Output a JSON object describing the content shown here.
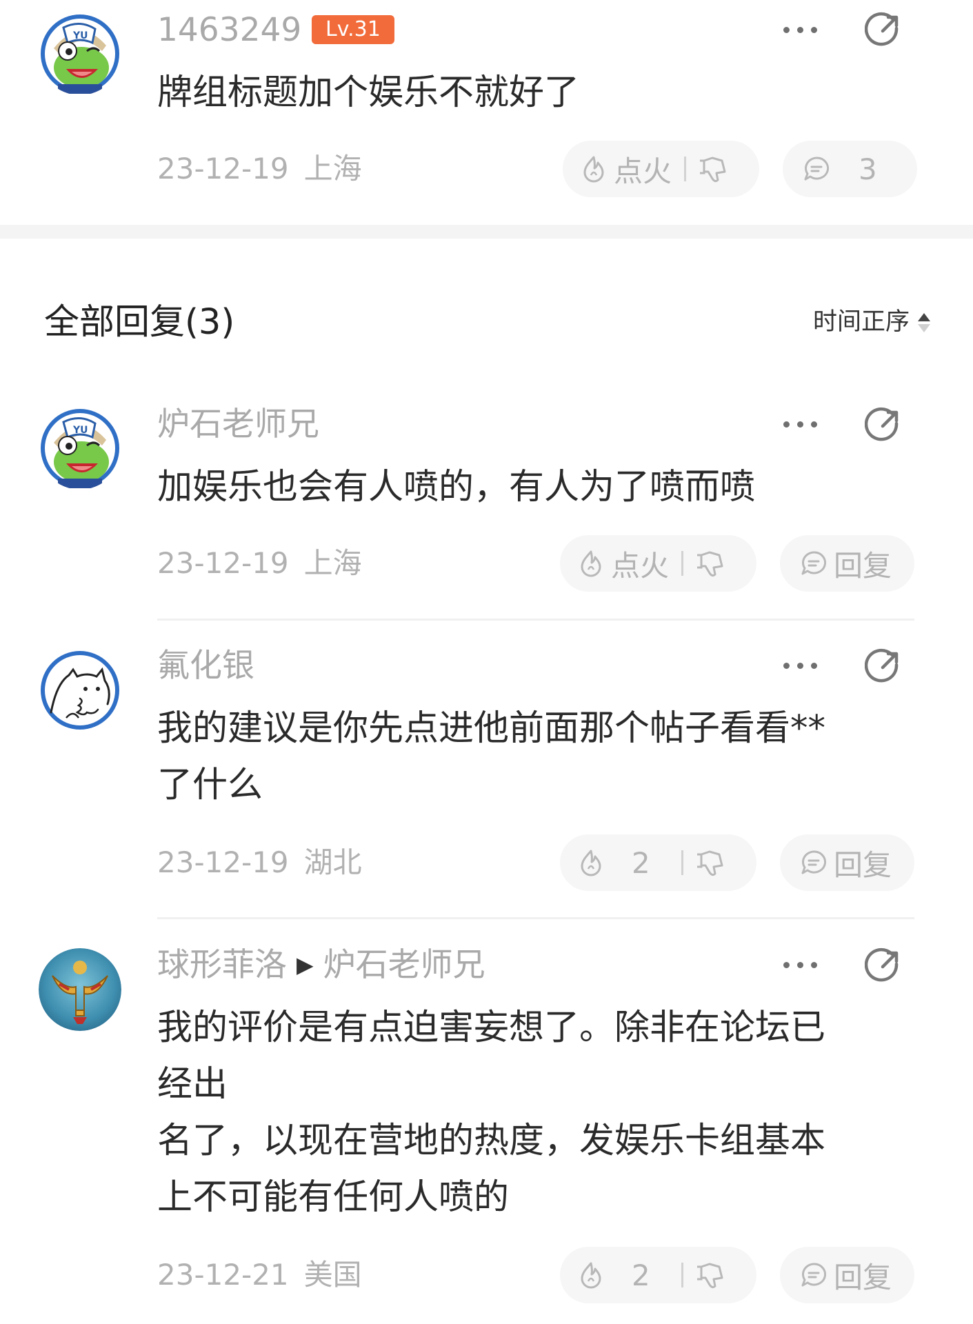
{
  "post": {
    "username": "1463249",
    "level": "Lv.31",
    "content": "牌组标题加个娱乐不就好了",
    "date": "23-12-19",
    "location": "上海",
    "fire_label": "点火",
    "reply_count": "3"
  },
  "replies_header": {
    "title": "全部回复(3)",
    "sort_label": "时间正序"
  },
  "replies": [
    {
      "username": "炉石老师兄",
      "reply_to": "",
      "content": "加娱乐也会有人喷的，有人为了喷而喷",
      "date": "23-12-19",
      "location": "上海",
      "fire_label": "点火",
      "reply_label": "回复"
    },
    {
      "username": "氟化银",
      "reply_to": "",
      "content": "我的建议是你先点进他前面那个帖子看看**\n了什么",
      "date": "23-12-19",
      "location": "湖北",
      "fire_count": "2",
      "reply_label": "回复"
    },
    {
      "username": "球形菲洛",
      "reply_to": "炉石老师兄",
      "content": "我的评价是有点迫害妄想了。除非在论坛已\n经出\n名了，以现在营地的热度，发娱乐卡组基本\n上不可能有任何人喷的",
      "date": "23-12-21",
      "location": "美国",
      "fire_count": "2",
      "reply_label": "回复"
    }
  ],
  "colors": {
    "level_badge": "#f26b3a",
    "muted_text": "#a9a9a9",
    "pill_bg": "#f6f6f6",
    "avatar_ring": "#2f6fc6"
  },
  "icons": {
    "more": "more-dots-icon",
    "share": "share-icon",
    "fire": "fire-icon",
    "dislike": "thumbs-down-icon",
    "comment": "comment-bubble-icon",
    "sort": "sort-arrows-icon"
  }
}
